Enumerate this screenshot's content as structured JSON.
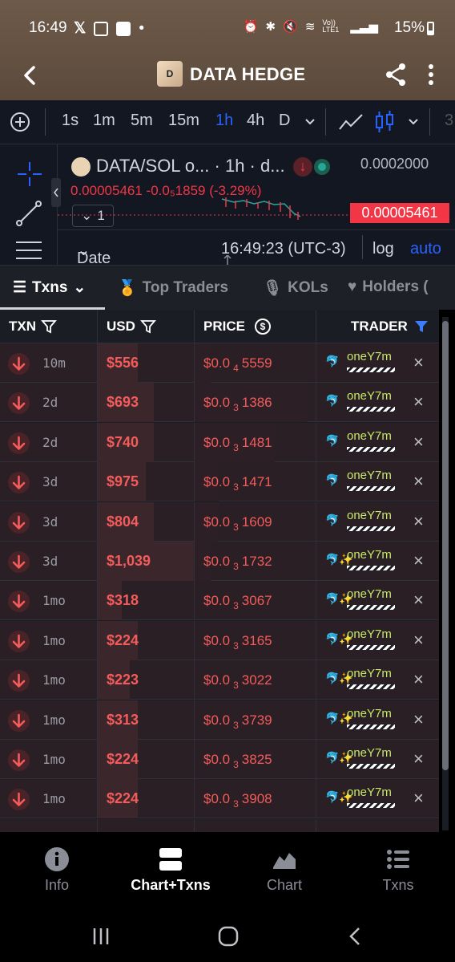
{
  "status_bar": {
    "time": "16:49",
    "network_label": "Vo)) LTE1",
    "battery": "15%"
  },
  "app_bar": {
    "logo_letter": "D",
    "title": "DATA HEDGE"
  },
  "chart_toolbar": {
    "intervals": [
      "1s",
      "1m",
      "5m",
      "15m",
      "1h",
      "4h",
      "D"
    ],
    "active_interval": "1h",
    "partial_right": "3"
  },
  "chart": {
    "legend_title": "DATA/SOL o... · 1h · d...",
    "legend_values": "0.00005461 -0.0₅1859 (-3.29%)",
    "y_top": "0.0002000",
    "price_tag": "0.00005461",
    "overlay_count": "1",
    "date_range_label": "Date Range",
    "clock": "16:49:23 (UTC-3)",
    "log_label": "log",
    "auto_label": "auto"
  },
  "tabs": [
    {
      "label": "Txns",
      "active": true
    },
    {
      "label": "Top Traders",
      "active": false
    },
    {
      "label": "KOLs",
      "active": false
    },
    {
      "label": "Holders (",
      "active": false
    }
  ],
  "table": {
    "headers": {
      "txn": "TXN",
      "usd": "USD",
      "price": "PRICE",
      "trader": "TRADER"
    },
    "rows": [
      {
        "age": "10m",
        "usd": "$556",
        "price_prefix": "$0.0",
        "price_sub": "4",
        "price_digits": "5559",
        "trader": "oneY7m",
        "sparkle": false
      },
      {
        "age": "2d",
        "usd": "$693",
        "price_prefix": "$0.0",
        "price_sub": "3",
        "price_digits": "1386",
        "trader": "oneY7m",
        "sparkle": false
      },
      {
        "age": "2d",
        "usd": "$740",
        "price_prefix": "$0.0",
        "price_sub": "3",
        "price_digits": "1481",
        "trader": "oneY7m",
        "sparkle": false
      },
      {
        "age": "3d",
        "usd": "$975",
        "price_prefix": "$0.0",
        "price_sub": "3",
        "price_digits": "1471",
        "trader": "oneY7m",
        "sparkle": false
      },
      {
        "age": "3d",
        "usd": "$804",
        "price_prefix": "$0.0",
        "price_sub": "3",
        "price_digits": "1609",
        "trader": "oneY7m",
        "sparkle": false
      },
      {
        "age": "3d",
        "usd": "$1,039",
        "price_prefix": "$0.0",
        "price_sub": "3",
        "price_digits": "1732",
        "trader": "oneY7m",
        "sparkle": true
      },
      {
        "age": "1mo",
        "usd": "$318",
        "price_prefix": "$0.0",
        "price_sub": "3",
        "price_digits": "3067",
        "trader": "oneY7m",
        "sparkle": true
      },
      {
        "age": "1mo",
        "usd": "$224",
        "price_prefix": "$0.0",
        "price_sub": "3",
        "price_digits": "3165",
        "trader": "oneY7m",
        "sparkle": true
      },
      {
        "age": "1mo",
        "usd": "$223",
        "price_prefix": "$0.0",
        "price_sub": "3",
        "price_digits": "3022",
        "trader": "oneY7m",
        "sparkle": true
      },
      {
        "age": "1mo",
        "usd": "$313",
        "price_prefix": "$0.0",
        "price_sub": "3",
        "price_digits": "3739",
        "trader": "oneY7m",
        "sparkle": true
      },
      {
        "age": "1mo",
        "usd": "$224",
        "price_prefix": "$0.0",
        "price_sub": "3",
        "price_digits": "3825",
        "trader": "oneY7m",
        "sparkle": true
      },
      {
        "age": "1mo",
        "usd": "$224",
        "price_prefix": "$0.0",
        "price_sub": "3",
        "price_digits": "3908",
        "trader": "oneY7m",
        "sparkle": true
      }
    ]
  },
  "bottom_nav": [
    {
      "label": "Info",
      "icon": "info-icon",
      "active": false
    },
    {
      "label": "Chart+Txns",
      "icon": "chart-txns-icon",
      "active": true
    },
    {
      "label": "Chart",
      "icon": "area-chart-icon",
      "active": false
    },
    {
      "label": "Txns",
      "icon": "list-icon",
      "active": false
    }
  ],
  "colors": {
    "sell_red": "#f45b5b",
    "accent_blue": "#2962ff",
    "trader_green": "#c8e86a",
    "header_brown": "#6e5a49"
  }
}
